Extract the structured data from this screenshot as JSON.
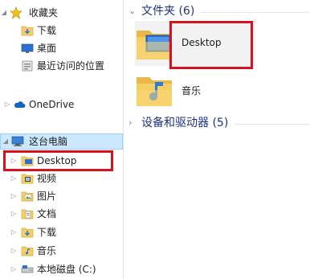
{
  "nav": {
    "favorites": {
      "label": "收藏夹",
      "items": [
        {
          "label": "下载",
          "icon": "downloads-folder-icon"
        },
        {
          "label": "桌面",
          "icon": "desktop-icon"
        },
        {
          "label": "最近访问的位置",
          "icon": "recent-places-icon"
        }
      ]
    },
    "onedrive": {
      "label": "OneDrive"
    },
    "this_pc": {
      "label": "这台电脑",
      "items": [
        {
          "label": "Desktop",
          "icon": "desktop-folder-icon"
        },
        {
          "label": "视频",
          "icon": "videos-folder-icon"
        },
        {
          "label": "图片",
          "icon": "pictures-folder-icon"
        },
        {
          "label": "文档",
          "icon": "documents-folder-icon"
        },
        {
          "label": "下载",
          "icon": "downloads-folder-icon"
        },
        {
          "label": "音乐",
          "icon": "music-folder-icon"
        },
        {
          "label": "本地磁盘 (C:)",
          "icon": "local-disk-icon"
        }
      ]
    }
  },
  "content": {
    "folders_group": {
      "title": "文件夹 (6)",
      "items": [
        {
          "label": "Desktop",
          "icon": "desktop-folder-icon"
        },
        {
          "label": "音乐",
          "icon": "music-folder-icon"
        }
      ]
    },
    "devices_group": {
      "title": "设备和驱动器 (5)"
    }
  },
  "colors": {
    "selection_bg": "#cce8ff",
    "group_header": "#1e3287",
    "annotation_red": "#d9101e",
    "folder_yellow": "#f5cf64"
  }
}
